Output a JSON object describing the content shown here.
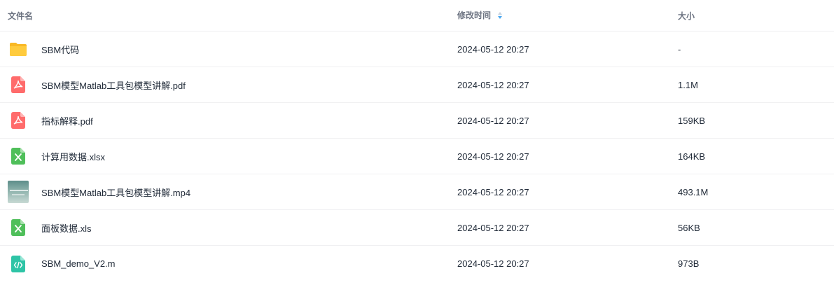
{
  "columns": {
    "name": "文件名",
    "modified": "修改时间",
    "size": "大小"
  },
  "colors": {
    "folder": "#ffc93a",
    "pdf": "#ff6b6b",
    "excel": "#4fbf5a",
    "code": "#2ec4a6",
    "sort_accent": "#4aa8f0"
  },
  "files": [
    {
      "name": "SBM代码",
      "modified": "2024-05-12 20:27",
      "size": "-",
      "icon": "folder-icon"
    },
    {
      "name": "SBM模型Matlab工具包模型讲解.pdf",
      "modified": "2024-05-12 20:27",
      "size": "1.1M",
      "icon": "pdf-icon"
    },
    {
      "name": "指标解释.pdf",
      "modified": "2024-05-12 20:27",
      "size": "159KB",
      "icon": "pdf-icon"
    },
    {
      "name": "计算用数据.xlsx",
      "modified": "2024-05-12 20:27",
      "size": "164KB",
      "icon": "excel-icon"
    },
    {
      "name": "SBM模型Matlab工具包模型讲解.mp4",
      "modified": "2024-05-12 20:27",
      "size": "493.1M",
      "icon": "video-thumbnail"
    },
    {
      "name": "面板数据.xls",
      "modified": "2024-05-12 20:27",
      "size": "56KB",
      "icon": "excel-icon"
    },
    {
      "name": "SBM_demo_V2.m",
      "modified": "2024-05-12 20:27",
      "size": "973B",
      "icon": "code-icon"
    }
  ]
}
